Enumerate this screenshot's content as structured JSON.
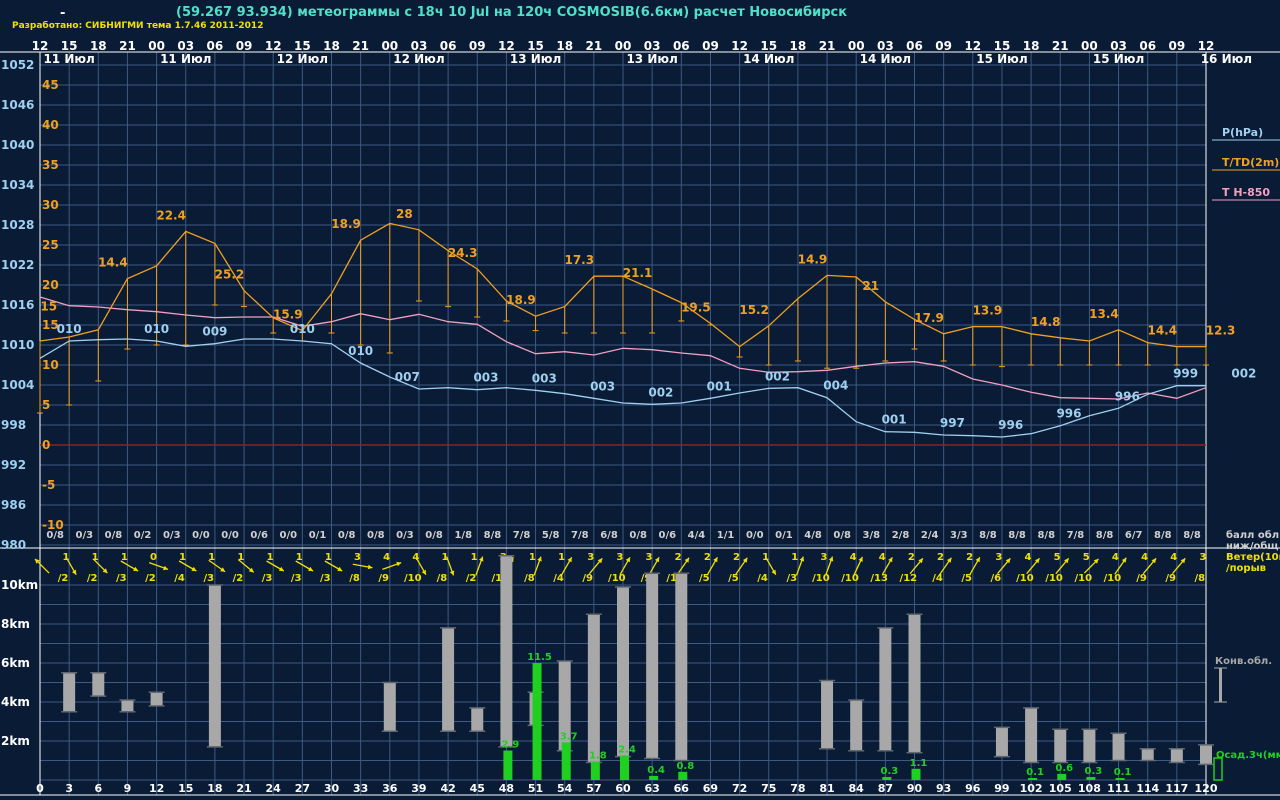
{
  "header": {
    "dash": "-",
    "title": "(59.267 93.934) метеограммы с  18ч 10 Jul на 120ч COSMOSIB(6.6км) расчет Новосибирск",
    "developer": "Разработано: СИБНИГМИ тема 1.7.46 2011-2012"
  },
  "colors": {
    "background": "#0a1b35",
    "grid": "#3c5a82",
    "pressure": "#9fd0f0",
    "temperature": "#f0a020",
    "t850": "#f0a0c0",
    "cloud_text": "#d0d0d0",
    "wind": "#f0e000",
    "convective": "#a8a8a8",
    "precip": "#20d020",
    "zero_line": "#902020"
  },
  "chart_data": [
    {
      "type": "line",
      "name": "meteogram-main",
      "top_hours": [
        "12",
        "15",
        "18",
        "21",
        "00",
        "03",
        "06",
        "09",
        "12",
        "15",
        "18",
        "21",
        "00",
        "03",
        "06",
        "09",
        "12",
        "15",
        "18",
        "21",
        "00",
        "03",
        "06",
        "09",
        "12",
        "15",
        "18",
        "21",
        "00",
        "03",
        "06",
        "09",
        "12",
        "15",
        "18",
        "21",
        "00",
        "03",
        "06",
        "09",
        "12"
      ],
      "date_labels": [
        {
          "text": "11 Июл",
          "step": 1
        },
        {
          "text": "11 Июл",
          "step": 5
        },
        {
          "text": "12 Июл",
          "step": 9
        },
        {
          "text": "12 Июл",
          "step": 13
        },
        {
          "text": "13 Июл",
          "step": 17
        },
        {
          "text": "13 Июл",
          "step": 21
        },
        {
          "text": "14 Июл",
          "step": 25
        },
        {
          "text": "14 Июл",
          "step": 29
        },
        {
          "text": "15 Июл",
          "step": 33
        },
        {
          "text": "15 Июл",
          "step": 37
        },
        {
          "text": "16 Июл",
          "step": 40.7
        }
      ],
      "pressure_axis": {
        "ticks": [
          "1052",
          "1046",
          "1040",
          "1034",
          "1028",
          "1022",
          "1016",
          "1010",
          "1004",
          "998",
          "992",
          "986",
          "980"
        ],
        "range": [
          980,
          1052
        ],
        "unit": "hPa"
      },
      "temperature_axis": {
        "ticks": [
          "45",
          "40",
          "35",
          "30",
          "25",
          "20",
          "15",
          "10",
          "5",
          "0",
          "-5",
          "-10"
        ],
        "range": [
          -14,
          50
        ],
        "unit": "°C"
      },
      "legend": [
        {
          "text": "P(hPa)",
          "color": "#9fd0f0"
        },
        {
          "text": "T/TD(2m)",
          "color": "#f0a020"
        },
        {
          "text": "T H-850",
          "color": "#f0a0c0"
        }
      ],
      "pressure": [
        1008.0,
        1010.6,
        1010.8,
        1010.9,
        1010.6,
        1009.8,
        1010.2,
        1010.9,
        1010.9,
        1010.6,
        1010.2,
        1007.3,
        1005.2,
        1003.4,
        1003.6,
        1003.3,
        1003.6,
        1003.2,
        1002.7,
        1002.0,
        1001.3,
        1001.1,
        1001.3,
        1002.0,
        1002.8,
        1003.5,
        1003.6,
        1002.1,
        998.5,
        997.0,
        996.9,
        996.5,
        996.4,
        996.2,
        996.7,
        997.9,
        999.4,
        1000.5,
        1002.6,
        1003.9,
        1003.9
      ],
      "pressure_labels": [
        {
          "step": 1,
          "text": "010"
        },
        {
          "step": 4,
          "text": "010"
        },
        {
          "step": 6,
          "text": "009"
        },
        {
          "step": 9,
          "text": "010"
        },
        {
          "step": 11,
          "text": "010"
        },
        {
          "step": 12.6,
          "text": "007"
        },
        {
          "step": 15.3,
          "text": "003"
        },
        {
          "step": 17.3,
          "text": "003"
        },
        {
          "step": 19.3,
          "text": "003"
        },
        {
          "step": 21.3,
          "text": "002"
        },
        {
          "step": 23.3,
          "text": "001"
        },
        {
          "step": 25.3,
          "text": "002"
        },
        {
          "step": 27.3,
          "text": "004"
        },
        {
          "step": 29.3,
          "text": "001"
        },
        {
          "step": 31.3,
          "text": "997"
        },
        {
          "step": 33.3,
          "text": "996"
        },
        {
          "step": 35.3,
          "text": "996"
        },
        {
          "step": 37.3,
          "text": "996"
        },
        {
          "step": 39.3,
          "text": "999"
        },
        {
          "step": 41.3,
          "text": "002"
        }
      ],
      "temperature": [
        13.0,
        13.5,
        14.4,
        20.8,
        22.4,
        26.7,
        25.2,
        19.3,
        15.9,
        14.3,
        18.9,
        25.6,
        27.7,
        26.9,
        24.3,
        22.0,
        18.0,
        16.1,
        17.3,
        21.1,
        21.1,
        19.5,
        17.8,
        15.2,
        12.3,
        14.9,
        18.3,
        21.2,
        21.0,
        17.9,
        15.7,
        13.9,
        14.8,
        14.8,
        13.9,
        13.4,
        13.0,
        14.4,
        12.8,
        12.3,
        12.3
      ],
      "temperature_labels": [
        {
          "step": 0.3,
          "text": "15",
          "value": 15.3
        },
        {
          "step": 2.5,
          "text": "14.4"
        },
        {
          "step": 4.5,
          "text": "22.4"
        },
        {
          "step": 6.5,
          "text": "25.2"
        },
        {
          "step": 8.5,
          "text": "15.9"
        },
        {
          "step": 10.5,
          "text": "18.9"
        },
        {
          "step": 12.5,
          "text": "28"
        },
        {
          "step": 14.5,
          "text": "24.3"
        },
        {
          "step": 16.5,
          "text": "18.9"
        },
        {
          "step": 18.5,
          "text": "17.3"
        },
        {
          "step": 20.5,
          "text": "21.1"
        },
        {
          "step": 22.5,
          "text": "19.5"
        },
        {
          "step": 24.5,
          "text": "15.2"
        },
        {
          "step": 26.5,
          "text": "14.9"
        },
        {
          "step": 28.5,
          "text": "21"
        },
        {
          "step": 30.5,
          "text": "17.9"
        },
        {
          "step": 32.5,
          "text": "13.9"
        },
        {
          "step": 34.5,
          "text": "14.8"
        },
        {
          "step": 36.5,
          "text": "13.4"
        },
        {
          "step": 38.5,
          "text": "14.4"
        },
        {
          "step": 40.5,
          "text": "12.3"
        }
      ],
      "dewpoint": [
        4.0,
        5.0,
        8.0,
        12.0,
        12.5,
        12.5,
        17.5,
        17.3,
        14.0,
        13.0,
        14.0,
        12.5,
        11.5,
        18.0,
        17.3,
        16.0,
        15.5,
        14.3,
        14.0,
        14.0,
        14.0,
        14.0,
        15.5,
        15.0,
        11.0,
        10.0,
        10.5,
        9.6,
        9.6,
        10.5,
        12.0,
        10.5,
        10.0,
        9.8,
        10.0,
        10.0,
        10.0,
        10.0,
        10.0,
        10.0,
        10.0
      ],
      "t850": [
        1017.2,
        1015.9,
        1015.7,
        1015.3,
        1015.0,
        1014.5,
        1014.1,
        1014.2,
        1014.2,
        1012.8,
        1013.5,
        1014.7,
        1013.8,
        1014.6,
        1013.5,
        1013.1,
        1010.5,
        1008.7,
        1009.0,
        1008.5,
        1009.5,
        1009.3,
        1008.8,
        1008.4,
        1006.5,
        1005.9,
        1006.0,
        1006.2,
        1006.8,
        1007.3,
        1007.5,
        1006.8,
        1004.9,
        1004.0,
        1002.9,
        1002.1,
        1002.0,
        1001.9,
        1002.8,
        1002.0,
        1003.6
      ]
    },
    {
      "type": "table",
      "name": "clouds-and-wind",
      "cloud_cover": [
        "0/8",
        "0/3",
        "0/8",
        "0/2",
        "0/3",
        "0/0",
        "0/0",
        "0/6",
        "0/0",
        "0/1",
        "0/8",
        "0/8",
        "0/3",
        "0/8",
        "1/8",
        "8/8",
        "7/8",
        "5/8",
        "7/8",
        "6/8",
        "0/8",
        "0/6",
        "4/4",
        "1/1",
        "0/0",
        "0/1",
        "4/8",
        "0/8",
        "3/8",
        "2/8",
        "2/4",
        "3/3",
        "8/8",
        "8/8",
        "8/8",
        "7/8",
        "8/8",
        "6/7",
        "8/8",
        "8/8"
      ],
      "cloud_label": [
        "балл обл.",
        "ниж/общ"
      ],
      "wind_label": [
        "Ветер(10м)",
        "/порыв"
      ],
      "wind": [
        {
          "dir": 315,
          "speed": "1",
          "gust": "/2"
        },
        {
          "dir": 150,
          "speed": "1",
          "gust": "/2"
        },
        {
          "dir": 135,
          "speed": "1",
          "gust": "/3"
        },
        {
          "dir": 120,
          "speed": "0",
          "gust": "/2"
        },
        {
          "dir": 110,
          "speed": "1",
          "gust": "/4"
        },
        {
          "dir": 120,
          "speed": "1",
          "gust": "/3"
        },
        {
          "dir": 125,
          "speed": "1",
          "gust": "/2"
        },
        {
          "dir": 130,
          "speed": "1",
          "gust": "/3"
        },
        {
          "dir": 120,
          "speed": "1",
          "gust": "/3"
        },
        {
          "dir": 120,
          "speed": "1",
          "gust": "/3"
        },
        {
          "dir": 120,
          "speed": "3",
          "gust": "/8"
        },
        {
          "dir": 100,
          "speed": "4",
          "gust": "/9"
        },
        {
          "dir": 70,
          "speed": "4",
          "gust": "/10"
        },
        {
          "dir": 150,
          "speed": "1",
          "gust": "/8"
        },
        {
          "dir": 160,
          "speed": "1",
          "gust": "/2"
        },
        {
          "dir": 20,
          "speed": "3",
          "gust": "/10"
        },
        {
          "dir": 30,
          "speed": "1",
          "gust": "/8"
        },
        {
          "dir": 20,
          "speed": "1",
          "gust": "/4"
        },
        {
          "dir": 30,
          "speed": "3",
          "gust": "/9"
        },
        {
          "dir": 40,
          "speed": "3",
          "gust": "/10"
        },
        {
          "dir": 30,
          "speed": "3",
          "gust": "/9"
        },
        {
          "dir": 30,
          "speed": "2",
          "gust": "/11"
        },
        {
          "dir": 35,
          "speed": "2",
          "gust": "/5"
        },
        {
          "dir": 30,
          "speed": "2",
          "gust": "/5"
        },
        {
          "dir": 35,
          "speed": "1",
          "gust": "/4"
        },
        {
          "dir": 150,
          "speed": "1",
          "gust": "/3"
        },
        {
          "dir": 20,
          "speed": "3",
          "gust": "/10"
        },
        {
          "dir": 20,
          "speed": "4",
          "gust": "/10"
        },
        {
          "dir": 25,
          "speed": "4",
          "gust": "/13"
        },
        {
          "dir": 30,
          "speed": "2",
          "gust": "/12"
        },
        {
          "dir": 40,
          "speed": "2",
          "gust": "/4"
        },
        {
          "dir": 35,
          "speed": "2",
          "gust": "/5"
        },
        {
          "dir": 30,
          "speed": "3",
          "gust": "/6"
        },
        {
          "dir": 40,
          "speed": "4",
          "gust": "/10"
        },
        {
          "dir": 40,
          "speed": "5",
          "gust": "/10"
        },
        {
          "dir": 40,
          "speed": "5",
          "gust": "/10"
        },
        {
          "dir": 45,
          "speed": "4",
          "gust": "/10"
        },
        {
          "dir": 35,
          "speed": "4",
          "gust": "/9"
        },
        {
          "dir": 40,
          "speed": "4",
          "gust": "/9"
        },
        {
          "dir": 40,
          "speed": "3",
          "gust": "/8"
        }
      ]
    },
    {
      "type": "bar",
      "name": "convection-and-precip",
      "hours": [
        "0",
        "3",
        "6",
        "9",
        "12",
        "15",
        "18",
        "21",
        "24",
        "27",
        "30",
        "33",
        "36",
        "39",
        "42",
        "45",
        "48",
        "51",
        "54",
        "57",
        "60",
        "63",
        "66",
        "69",
        "72",
        "75",
        "78",
        "81",
        "84",
        "87",
        "90",
        "93",
        "96",
        "99",
        "102",
        "105",
        "108",
        "111",
        "114",
        "117",
        "120"
      ],
      "height_axis": {
        "ticks": [
          "10km",
          "8km",
          "6km",
          "4km",
          "2km"
        ],
        "range": [
          0,
          11
        ],
        "unit": "km"
      },
      "legend": [
        {
          "text": "Конв.обл.",
          "color": "#a8a8a8"
        },
        {
          "text": "Осад.3ч(мм)",
          "color": "#20d020"
        }
      ],
      "convective_clouds": [
        {
          "hour": 3,
          "base": 3.5,
          "top": 5.5
        },
        {
          "hour": 6,
          "base": 4.3,
          "top": 5.5
        },
        {
          "hour": 9,
          "base": 3.5,
          "top": 4.1
        },
        {
          "hour": 12,
          "base": 3.8,
          "top": 4.5
        },
        {
          "hour": 18,
          "base": 1.7,
          "top": 10.0
        },
        {
          "hour": 36,
          "base": 2.5,
          "top": 5.0
        },
        {
          "hour": 42,
          "base": 2.5,
          "top": 7.8
        },
        {
          "hour": 45,
          "base": 2.5,
          "top": 3.7
        },
        {
          "hour": 48,
          "base": 1.7,
          "top": 11.5
        },
        {
          "hour": 51,
          "base": 2.8,
          "top": 4.5
        },
        {
          "hour": 54,
          "base": 1.5,
          "top": 6.1
        },
        {
          "hour": 57,
          "base": 0.9,
          "top": 8.5
        },
        {
          "hour": 60,
          "base": 1.2,
          "top": 9.9
        },
        {
          "hour": 63,
          "base": 1.1,
          "top": 10.6
        },
        {
          "hour": 66,
          "base": 1.0,
          "top": 10.6
        },
        {
          "hour": 81,
          "base": 1.6,
          "top": 5.1
        },
        {
          "hour": 84,
          "base": 1.5,
          "top": 4.1
        },
        {
          "hour": 87,
          "base": 1.5,
          "top": 7.8
        },
        {
          "hour": 90,
          "base": 1.4,
          "top": 8.5
        },
        {
          "hour": 99,
          "base": 1.2,
          "top": 2.7
        },
        {
          "hour": 102,
          "base": 0.9,
          "top": 3.7
        },
        {
          "hour": 105,
          "base": 0.9,
          "top": 2.6
        },
        {
          "hour": 108,
          "base": 0.9,
          "top": 2.6
        },
        {
          "hour": 111,
          "base": 1.0,
          "top": 2.4
        },
        {
          "hour": 114,
          "base": 1.0,
          "top": 1.6
        },
        {
          "hour": 117,
          "base": 0.9,
          "top": 1.6
        },
        {
          "hour": 120,
          "base": 0.8,
          "top": 1.8
        }
      ],
      "precipitation": [
        {
          "hour": 48,
          "mm": 2.9,
          "label": "2.9"
        },
        {
          "hour": 51,
          "mm": 11.5,
          "label": "11.5"
        },
        {
          "hour": 54,
          "mm": 3.7,
          "label": "3.7"
        },
        {
          "hour": 57,
          "mm": 1.8,
          "label": "1.8"
        },
        {
          "hour": 60,
          "mm": 2.4,
          "label": "2.4"
        },
        {
          "hour": 63,
          "mm": 0.4,
          "label": "0.4"
        },
        {
          "hour": 66,
          "mm": 0.8,
          "label": "0.8"
        },
        {
          "hour": 87,
          "mm": 0.3,
          "label": "0.3"
        },
        {
          "hour": 90,
          "mm": 1.1,
          "label": "1.1"
        },
        {
          "hour": 102,
          "mm": 0.1,
          "label": "0.1"
        },
        {
          "hour": 105,
          "mm": 0.6,
          "label": "0.6"
        },
        {
          "hour": 108,
          "mm": 0.3,
          "label": "0.3"
        },
        {
          "hour": 111,
          "mm": 0.1,
          "label": "0.1"
        }
      ]
    }
  ]
}
